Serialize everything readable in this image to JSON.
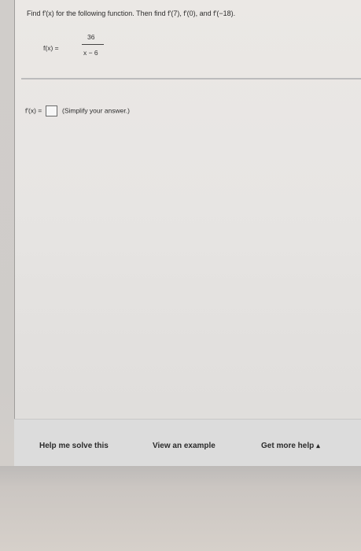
{
  "question": {
    "text": "Find f'(x) for the following function. Then find f'(7), f'(0), and f'(−18)."
  },
  "function": {
    "lhs": "f(x) =",
    "numerator": "36",
    "denominator": "x − 6"
  },
  "answer": {
    "label": "f'(x) =",
    "input_value": "",
    "hint": "(Simplify your answer.)"
  },
  "toolbar": {
    "help_label": "Help me solve this",
    "example_label": "View an example",
    "more_help_label": "Get more help",
    "more_help_caret": "▴"
  }
}
